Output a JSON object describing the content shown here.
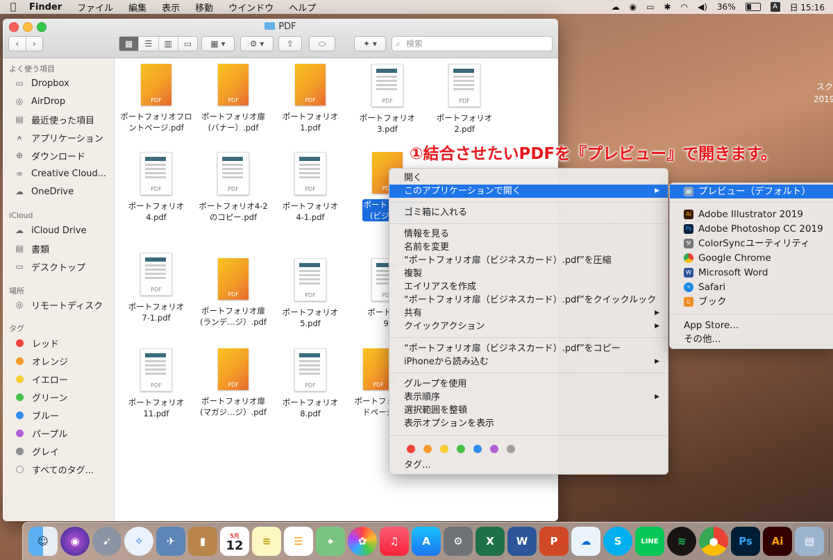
{
  "menubar": {
    "app": "Finder",
    "menus": [
      "ファイル",
      "編集",
      "表示",
      "移動",
      "ウインドウ",
      "ヘルプ"
    ],
    "battery": "36%",
    "input": "A",
    "clock": "日 15:16"
  },
  "desktop": {
    "text": "スク\n2019"
  },
  "window": {
    "title": "PDF",
    "search_placeholder": "検索"
  },
  "sidebar": {
    "favorites_header": "よく使う項目",
    "favorites": [
      "Dropbox",
      "AirDrop",
      "最近使った項目",
      "アプリケーション",
      "ダウンロード",
      "Creative Cloud...",
      "OneDrive"
    ],
    "icloud_header": "iCloud",
    "icloud": [
      "iCloud Drive",
      "書類",
      "デスクトップ"
    ],
    "places_header": "場所",
    "places": [
      "リモートディスク"
    ],
    "tags_header": "タグ",
    "tags": [
      {
        "name": "レッド",
        "color": "#f0433a"
      },
      {
        "name": "オレンジ",
        "color": "#f79a2c"
      },
      {
        "name": "イエロー",
        "color": "#f7cd32"
      },
      {
        "name": "グリーン",
        "color": "#47c04a"
      },
      {
        "name": "ブルー",
        "color": "#2f8ef0"
      },
      {
        "name": "パープル",
        "color": "#b160d6"
      },
      {
        "name": "グレイ",
        "color": "#8e8e93"
      },
      {
        "name": "すべてのタグ...",
        "color": ""
      }
    ]
  },
  "files": [
    {
      "line1": "ポートフォリオフロ",
      "line2": "ントページ.pdf",
      "style": "orange"
    },
    {
      "line1": "ポートフォリオ扉",
      "line2": "(バナー）.pdf",
      "style": "orange"
    },
    {
      "line1": "ポートフォリオ",
      "line2": "1.pdf",
      "style": "orange"
    },
    {
      "line1": "ポートフォリオ",
      "line2": "3.pdf",
      "style": "doc"
    },
    {
      "line1": "ポートフォリオ",
      "line2": "2.pdf",
      "style": "doc"
    },
    {
      "line1": "ポートフォリオ",
      "line2": "4.pdf",
      "style": "doc"
    },
    {
      "line1": "ポートフォリオ4-2",
      "line2": "のコピー.pdf",
      "style": "doc"
    },
    {
      "line1": "ポートフォリオ",
      "line2": "4-1.pdf",
      "style": "doc"
    },
    {
      "line1": "ポートフォリ",
      "line2": "(ビジネ...",
      "style": "orange"
    },
    {
      "line1": "ポートフォリオ",
      "line2": "7-1.pdf",
      "style": "doc"
    },
    {
      "line1": "ポートフォリオ扉",
      "line2": "(ランデ…ジ）.pdf",
      "style": "orange"
    },
    {
      "line1": "ポートフォリオ",
      "line2": "5.pdf",
      "style": "doc"
    },
    {
      "line1": "ポートフォ",
      "line2": "9.",
      "style": "doc"
    },
    {
      "line1": "ポートフォリオ",
      "line2": "11.pdf",
      "style": "doc"
    },
    {
      "line1": "ポートフォリオ扉",
      "line2": "(マガジ…ジ）.pdf",
      "style": "orange"
    },
    {
      "line1": "ポートフォリオ",
      "line2": "8.pdf",
      "style": "doc"
    },
    {
      "line1": "ポートフォリ",
      "line2": "ドページ",
      "style": "orange"
    }
  ],
  "context_menu": {
    "open": "開く",
    "open_with": "このアプリケーションで開く",
    "trash": "ゴミ箱に入れる",
    "get_info": "情報を見る",
    "rename": "名前を変更",
    "compress": "“ポートフォリオ扉（ビジネスカード）.pdf”を圧縮",
    "duplicate": "複製",
    "alias": "エイリアスを作成",
    "quicklook": "“ポートフォリオ扉（ビジネスカード）.pdf”をクイックルック",
    "share": "共有",
    "quick_actions": "クイックアクション",
    "copy": "“ポートフォリオ扉（ビジネスカード）.pdf”をコピー",
    "import_iphone": "iPhoneから読み込む",
    "use_groups": "グループを使用",
    "sort_by": "表示順序",
    "clean_up": "選択範囲を整頓",
    "view_options": "表示オプションを表示",
    "tags": "タグ...",
    "tag_colors": [
      "#f0433a",
      "#f79a2c",
      "#f7cd32",
      "#47c04a",
      "#2f8ef0",
      "#b160d6",
      "#a0a0a0"
    ]
  },
  "submenu": {
    "default_app": "プレビュー（デフォルト）",
    "apps": [
      "Adobe Illustrator 2019",
      "Adobe Photoshop CC 2019",
      "ColorSyncユーティリティ",
      "Google Chrome",
      "Microsoft Word",
      "Safari",
      "ブック"
    ],
    "app_store": "App Store...",
    "other": "その他..."
  },
  "annotation": "①結合させたいPDFを『プレビュー』で開きます。",
  "dock": {
    "calendar_month": "5月",
    "calendar_day": "12"
  }
}
